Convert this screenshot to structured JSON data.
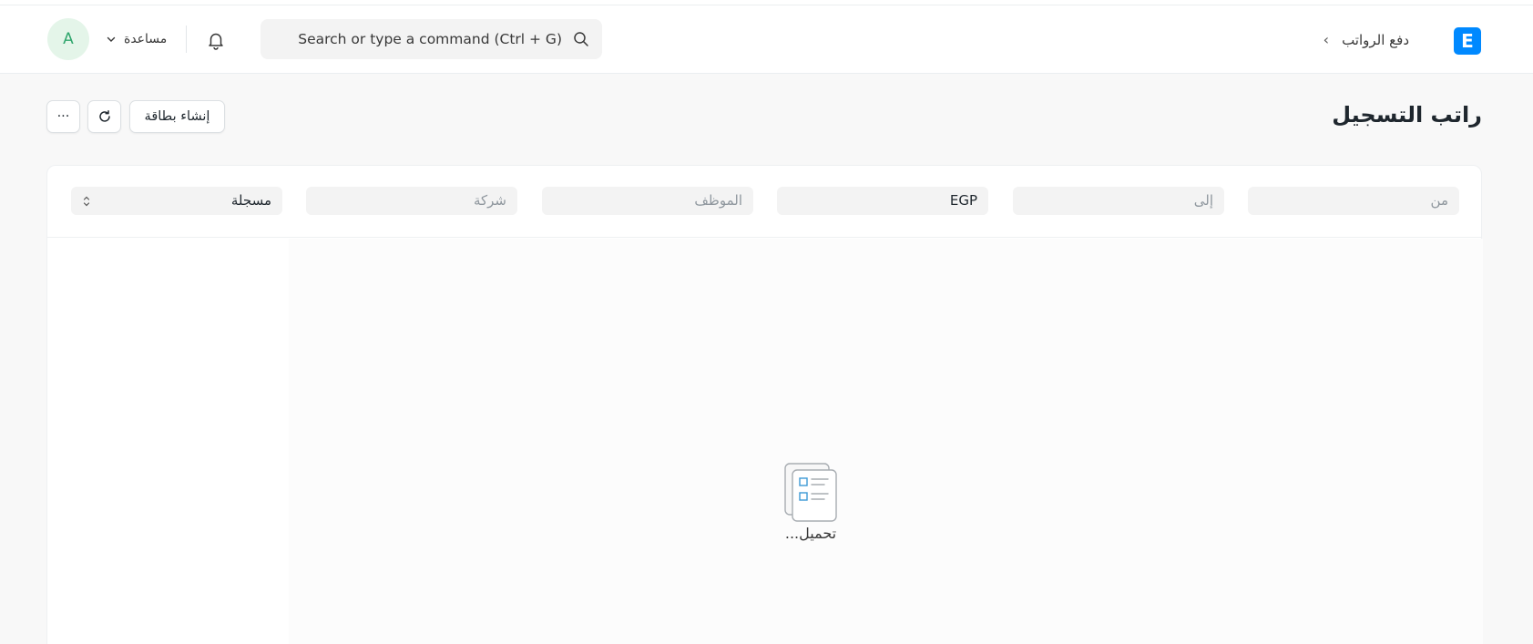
{
  "navbar": {
    "avatar_initial": "A",
    "help_label": "مساعدة",
    "search_placeholder": "Search or type a command (Ctrl + G)",
    "breadcrumb": "دفع الرواتب",
    "breadcrumb_separator": "›",
    "logo_letter": "E"
  },
  "page": {
    "title": "راتب التسجيل",
    "buttons": {
      "new_card": "إنشاء بطاقة",
      "more": "···"
    }
  },
  "filters": {
    "from": "من",
    "to": "إلى",
    "currency": "EGP",
    "employee": "الموظف",
    "company": "شركة",
    "status": "مسجلة"
  },
  "content": {
    "loading_text": "تحميل..."
  },
  "colors": {
    "accent": "#0089ff",
    "avatar_bg": "#e4f5e9",
    "avatar_text": "#30a66d"
  }
}
